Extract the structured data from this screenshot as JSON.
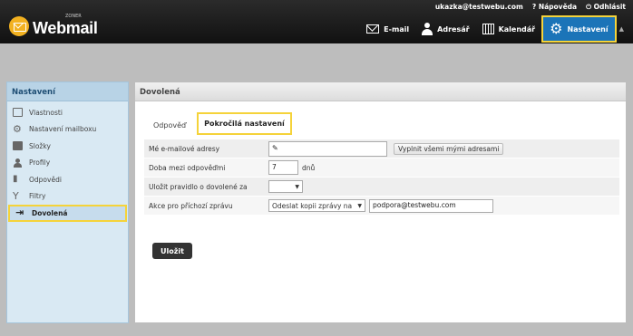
{
  "brand": {
    "name": "Webmail",
    "zoner": "ZONER"
  },
  "user_bar": {
    "account": "ukazka@testwebu.com",
    "help": "Nápověda",
    "logout": "Odhlásit",
    "help_icon": "question-icon",
    "logout_icon": "power-icon"
  },
  "nav": {
    "items": [
      {
        "label": "E-mail",
        "icon": "mail-icon"
      },
      {
        "label": "Adresář",
        "icon": "person-icon"
      },
      {
        "label": "Kalendář",
        "icon": "calendar-icon"
      },
      {
        "label": "Nastavení",
        "icon": "gear-icon",
        "active": true
      }
    ],
    "arrow": "▲"
  },
  "sidebar": {
    "title": "Nastavení",
    "items": [
      {
        "label": "Vlastnosti",
        "icon": "monitor-icon"
      },
      {
        "label": "Nastavení mailboxu",
        "icon": "gear-icon"
      },
      {
        "label": "Složky",
        "icon": "folder-icon"
      },
      {
        "label": "Profily",
        "icon": "profile-icon"
      },
      {
        "label": "Odpovědi",
        "icon": "reply-icon"
      },
      {
        "label": "Filtry",
        "icon": "filter-icon"
      },
      {
        "label": "Dovolená",
        "icon": "leave-icon",
        "active": true
      }
    ]
  },
  "main": {
    "title": "Dovolená",
    "tabs": [
      {
        "label": "Odpověď"
      },
      {
        "label": "Pokročilá nastavení",
        "active": true
      }
    ],
    "form": {
      "addresses_label": "Mé e-mailové adresy",
      "addresses_value": "",
      "fill_button": "Vyplnit všemi mými adresami",
      "interval_label": "Doba mezi odpověďmi",
      "interval_value": "7",
      "interval_unit": "dnů",
      "save_rule_label": "Uložit pravidlo o dovolené za",
      "save_rule_value": "",
      "incoming_label": "Akce pro příchozí zprávu",
      "incoming_action": "Odeslat kopii zprávy na",
      "incoming_target": "podpora@testwebu.com"
    },
    "save_button": "Uložit"
  },
  "colors": {
    "accent": "#1b74b8",
    "highlight": "#f5d33a",
    "topbar": "#1a1a1a"
  }
}
